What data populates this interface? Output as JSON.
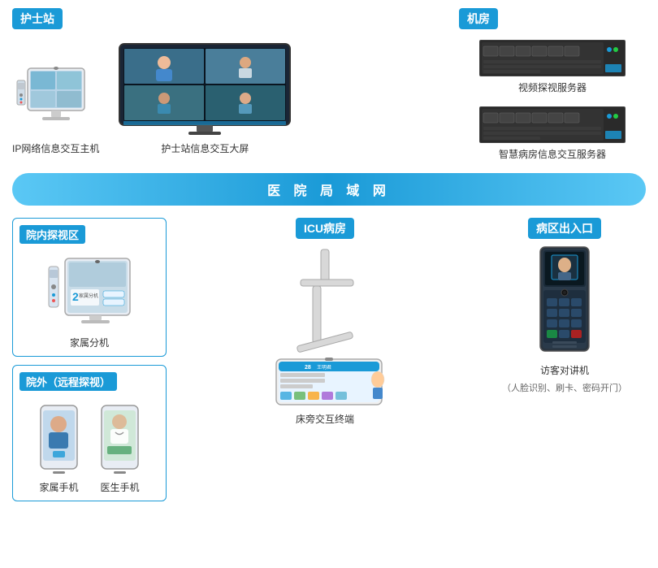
{
  "sections": {
    "nurse_station": "护士站",
    "machine_room": "机房",
    "network_bar": "医 院 局 域 网",
    "indoor_area": "院内探视区",
    "outdoor_area": "院外（远程探视）",
    "icu_room": "ICU病房",
    "ward_exit": "病区出入口"
  },
  "devices": {
    "ip_host": "IP网络信息交互主机",
    "nurse_screen": "护士站信息交互大屏",
    "video_server": "视频探视服务器",
    "smart_server": "智慧病房信息交互服务器",
    "family_extension": "家属分机",
    "family_phone": "家属手机",
    "doctor_phone": "医生手机",
    "bed_terminal": "床旁交互终端",
    "visitor_intercom": "访客对讲机",
    "visitor_intercom_sub": "（人脸识别、刷卡、密码开门）"
  },
  "colors": {
    "brand_blue": "#1a9ad7",
    "light_blue": "#5bc8f5"
  }
}
